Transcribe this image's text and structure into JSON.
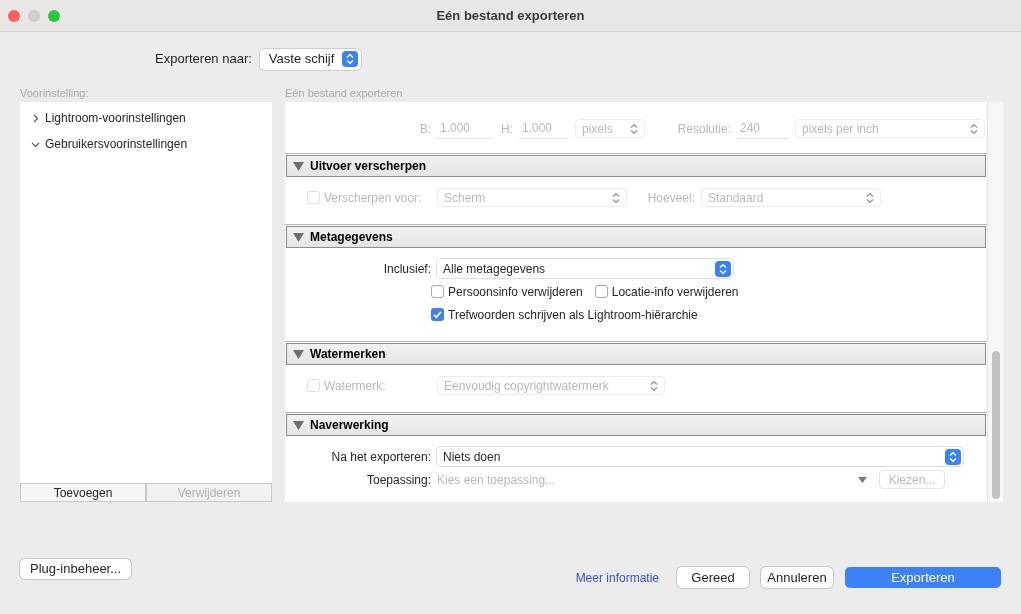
{
  "window": {
    "title": "Eén bestand exporteren"
  },
  "export_to": {
    "label": "Exporteren naar:",
    "value": "Vaste schijf"
  },
  "presets": {
    "label": "Voorinstelling:",
    "items": [
      {
        "label": "Lightroom-voorinstellingen",
        "expanded": false
      },
      {
        "label": "Gebruikersvoorinstellingen",
        "expanded": true
      }
    ],
    "buttons": [
      {
        "label": "Toevoegen",
        "disabled": false
      },
      {
        "label": "Verwijderen",
        "disabled": true
      }
    ]
  },
  "settings": {
    "title": "Eén bestand exporteren",
    "top_row": {
      "items": [
        {
          "kind": "label",
          "text": "B:",
          "disabled": true
        },
        {
          "kind": "field",
          "value": "1.000",
          "disabled": true
        },
        {
          "kind": "label",
          "text": "H:",
          "disabled": true
        },
        {
          "kind": "field",
          "value": "1.000",
          "disabled": true
        },
        {
          "kind": "select",
          "value": "pixels",
          "disabled": true
        },
        {
          "kind": "label",
          "text": "Resolutie:",
          "disabled": true
        },
        {
          "kind": "field",
          "value": "240",
          "disabled": true
        },
        {
          "kind": "select",
          "value": "pixels per inch",
          "disabled": true
        }
      ]
    },
    "sections": [
      {
        "title": "Uitvoer verscherpen",
        "expanded": true,
        "rows": [
          {
            "items": [
              {
                "kind": "checkbox",
                "label": "Verscherpen voor:",
                "checked": false,
                "disabled": true
              },
              {
                "kind": "select",
                "value": "Scherm",
                "disabled": true
              },
              {
                "kind": "label",
                "text": "Hoeveel:",
                "disabled": true
              },
              {
                "kind": "select",
                "value": "Standaard",
                "disabled": true
              }
            ]
          }
        ]
      },
      {
        "title": "Metagegevens",
        "expanded": true,
        "rows": [
          {
            "items": [
              {
                "kind": "label",
                "text": "Inclusief:",
                "disabled": false
              },
              {
                "kind": "select",
                "value": "Alle metagegevens",
                "disabled": false
              }
            ]
          },
          {
            "items": [
              {
                "kind": "checkbox",
                "label": "Persoonsinfo verwijderen",
                "checked": false,
                "disabled": false
              },
              {
                "kind": "checkbox",
                "label": "Locatie-info verwijderen",
                "checked": false,
                "disabled": false
              }
            ]
          },
          {
            "items": [
              {
                "kind": "checkbox",
                "label": "Trefwoorden schrijven als Lightroom-hiërarchie",
                "checked": true,
                "disabled": false
              }
            ]
          }
        ]
      },
      {
        "title": "Watermerken",
        "expanded": true,
        "rows": [
          {
            "items": [
              {
                "kind": "checkbox",
                "label": "Watermerk:",
                "checked": false,
                "disabled": true
              },
              {
                "kind": "select",
                "value": "Eenvoudig copyrightwatermerk",
                "disabled": true
              }
            ]
          }
        ]
      },
      {
        "title": "Naverwerking",
        "expanded": true,
        "rows": [
          {
            "items": [
              {
                "kind": "label",
                "text": "Na het exporteren:",
                "disabled": false
              },
              {
                "kind": "select",
                "value": "Niets doen",
                "disabled": false
              }
            ]
          },
          {
            "items": [
              {
                "kind": "label",
                "text": "Toepassing:",
                "disabled": false
              },
              {
                "kind": "app",
                "placeholder": "Kies een toepassing...",
                "disabled": false
              },
              {
                "kind": "button",
                "label": "Kiezen...",
                "disabled": true
              }
            ]
          }
        ]
      }
    ]
  },
  "footer": {
    "plugin_button": "Plug-inbeheer...",
    "link": "Meer informatie",
    "buttons": [
      {
        "label": "Gereed",
        "primary": false
      },
      {
        "label": "Annuleren",
        "primary": false
      },
      {
        "label": "Exporteren",
        "primary": true
      }
    ]
  }
}
